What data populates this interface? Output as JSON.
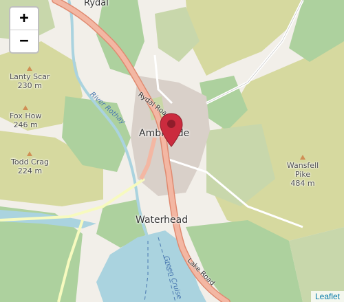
{
  "map": {
    "zoom_in_label": "+",
    "zoom_out_label": "−",
    "attribution": "Leaflet",
    "places": {
      "rydal": "Rydal",
      "ambleside": "Ambleside",
      "waterhead": "Waterhead"
    },
    "peaks": [
      {
        "name": "Lanty Scar",
        "elevation": "230 m"
      },
      {
        "name": "Fox How",
        "elevation": "246 m"
      },
      {
        "name": "Todd Crag",
        "elevation": "224 m"
      },
      {
        "name": "Wansfell Pike",
        "elevation": "484 m"
      }
    ],
    "roads": {
      "rydal_road": "Rydal Road",
      "lake_road": "Lake Road"
    },
    "waterways": {
      "river": "River Rothay",
      "lake_route": "Green Cruise"
    },
    "colors": {
      "land": "#f2efe9",
      "forest": "#add19e",
      "scrub": "#c8d7ab",
      "heath": "#d6d99f",
      "water": "#aad3df",
      "primary_road": "#f3b7a3",
      "road_casing": "#e08a70",
      "marker": "#cb2b3e"
    }
  }
}
